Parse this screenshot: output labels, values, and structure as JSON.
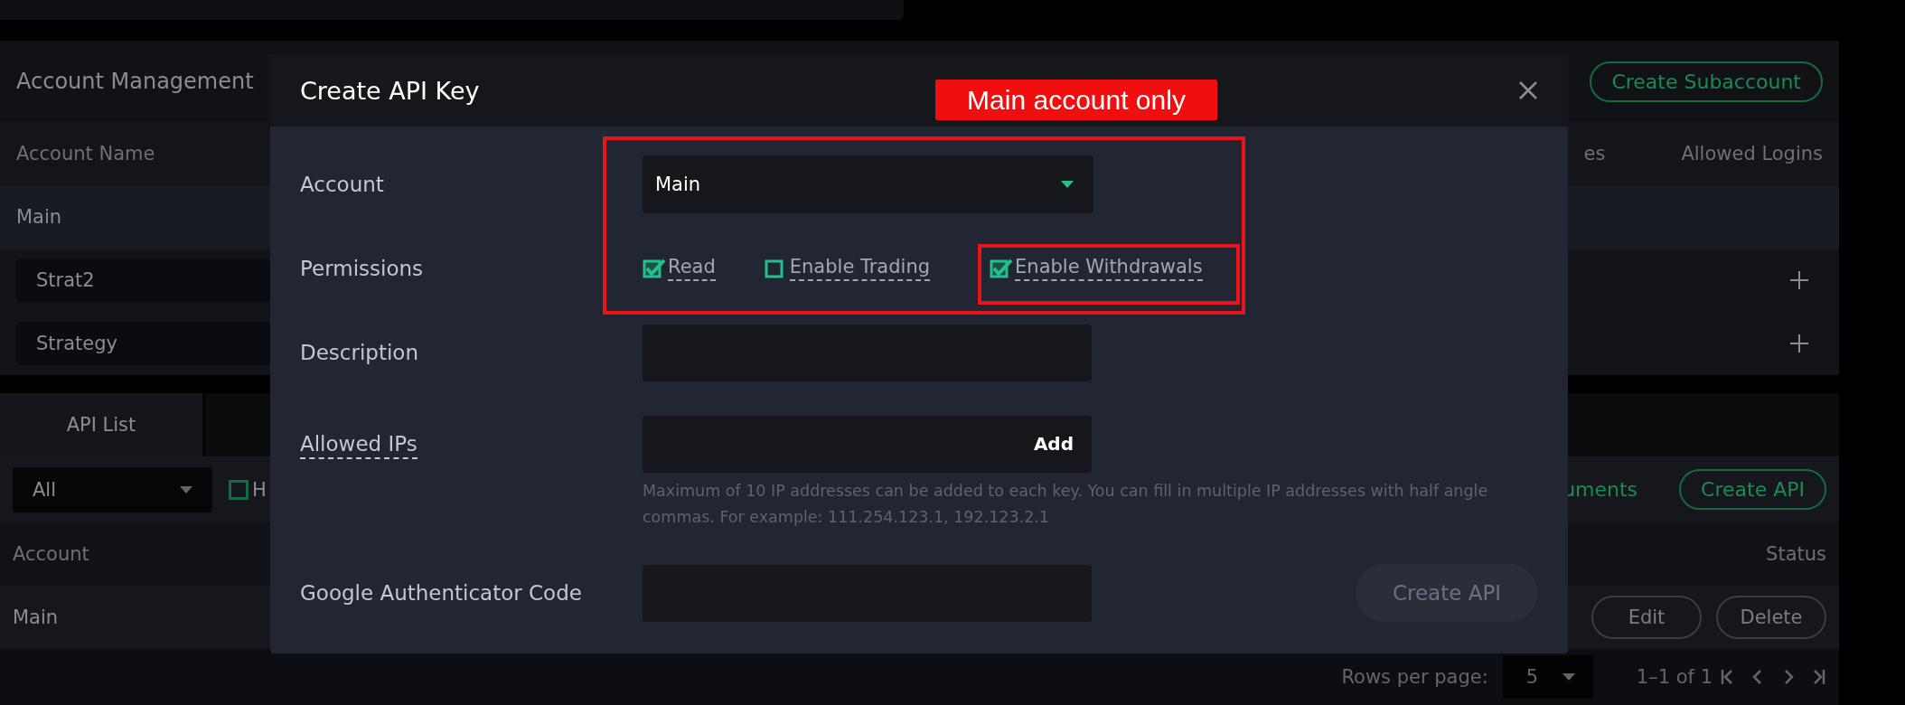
{
  "account_management": {
    "title": "Account Management",
    "create_button": "Create Subaccount",
    "columns": [
      {
        "label": "Account Name"
      },
      {
        "label": "es"
      },
      {
        "label": "Allowed Logins"
      }
    ],
    "rows": [
      {
        "kind": "plain",
        "name": "Main"
      },
      {
        "kind": "field",
        "name": "Strat2"
      },
      {
        "kind": "field",
        "name": "Strategy"
      }
    ]
  },
  "api_section": {
    "tabs": [
      {
        "label": "API List",
        "selected": true
      }
    ],
    "filter": {
      "value": "All"
    },
    "toggle": {
      "label": "H",
      "checked": false
    },
    "docs_link": "uments",
    "create_button": "Create API",
    "columns": [
      {
        "label": "Account"
      },
      {
        "label": "Status"
      }
    ],
    "rows": [
      {
        "account": "Main",
        "actions": [
          "Edit",
          "Delete"
        ]
      }
    ],
    "footer": {
      "rows_label": "Rows per page:",
      "rows_value": "5",
      "range": "1–1 of 1"
    }
  },
  "modal": {
    "title": "Create API Key",
    "rows": [
      {
        "kind": "select",
        "label": "Account",
        "underlined": false,
        "value": "Main"
      },
      {
        "kind": "checks",
        "label": "Permissions",
        "underlined": false,
        "options": [
          {
            "label": "Read",
            "checked": true
          },
          {
            "label": "Enable Trading",
            "checked": false
          },
          {
            "label": "Enable Withdrawals",
            "checked": true
          }
        ]
      },
      {
        "kind": "input",
        "label": "Description",
        "underlined": false
      },
      {
        "kind": "input_add",
        "label": "Allowed IPs",
        "underlined": true,
        "action": "Add",
        "hint": "Maximum of 10 IP addresses can be added to each key. You can fill in multiple IP addresses with half angle commas. For example: 111.254.123.1, 192.123.2.1"
      },
      {
        "kind": "input",
        "label": "Google Authenticator Code",
        "underlined": false
      }
    ],
    "submit": {
      "label": "Create API",
      "disabled": true
    }
  },
  "annotation": {
    "label": "Main account only"
  }
}
